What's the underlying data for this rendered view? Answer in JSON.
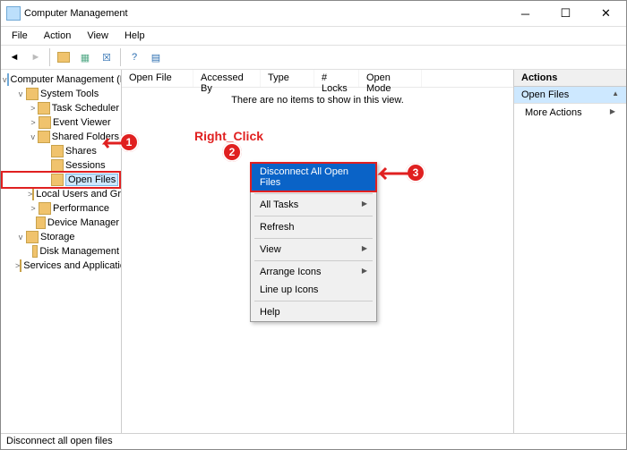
{
  "window": {
    "title": "Computer Management"
  },
  "menubar": {
    "items": [
      "File",
      "Action",
      "View",
      "Help"
    ]
  },
  "tree": {
    "root": "Computer Management (Local)",
    "items": [
      {
        "depth": 1,
        "exp": "v",
        "label": "System Tools"
      },
      {
        "depth": 2,
        "exp": ">",
        "label": "Task Scheduler"
      },
      {
        "depth": 2,
        "exp": ">",
        "label": "Event Viewer"
      },
      {
        "depth": 2,
        "exp": "v",
        "label": "Shared Folders"
      },
      {
        "depth": 3,
        "exp": "",
        "label": "Shares"
      },
      {
        "depth": 3,
        "exp": "",
        "label": "Sessions"
      },
      {
        "depth": 3,
        "exp": "",
        "label": "Open Files",
        "selected": true
      },
      {
        "depth": 2,
        "exp": ">",
        "label": "Local Users and Groups"
      },
      {
        "depth": 2,
        "exp": ">",
        "label": "Performance"
      },
      {
        "depth": 2,
        "exp": "",
        "label": "Device Manager"
      },
      {
        "depth": 1,
        "exp": "v",
        "label": "Storage"
      },
      {
        "depth": 2,
        "exp": "",
        "label": "Disk Management"
      },
      {
        "depth": 1,
        "exp": ">",
        "label": "Services and Applications"
      }
    ]
  },
  "list": {
    "columns": [
      "Open File",
      "Accessed By",
      "Type",
      "# Locks",
      "Open Mode"
    ],
    "empty_text": "There are no items to show in this view."
  },
  "context_menu": {
    "items": [
      {
        "label": "Disconnect All Open Files",
        "hl": true
      },
      {
        "sep": true
      },
      {
        "label": "All Tasks",
        "sub": true
      },
      {
        "sep": true
      },
      {
        "label": "Refresh"
      },
      {
        "sep": true
      },
      {
        "label": "View",
        "sub": true
      },
      {
        "sep": true
      },
      {
        "label": "Arrange Icons",
        "sub": true
      },
      {
        "label": "Line up Icons"
      },
      {
        "sep": true
      },
      {
        "label": "Help"
      }
    ]
  },
  "actions": {
    "header": "Actions",
    "selected": "Open Files",
    "more": "More Actions"
  },
  "status": "Disconnect all open files",
  "annotations": {
    "right_click": "Right_Click",
    "b1": "1",
    "b2": "2",
    "b3": "3"
  }
}
